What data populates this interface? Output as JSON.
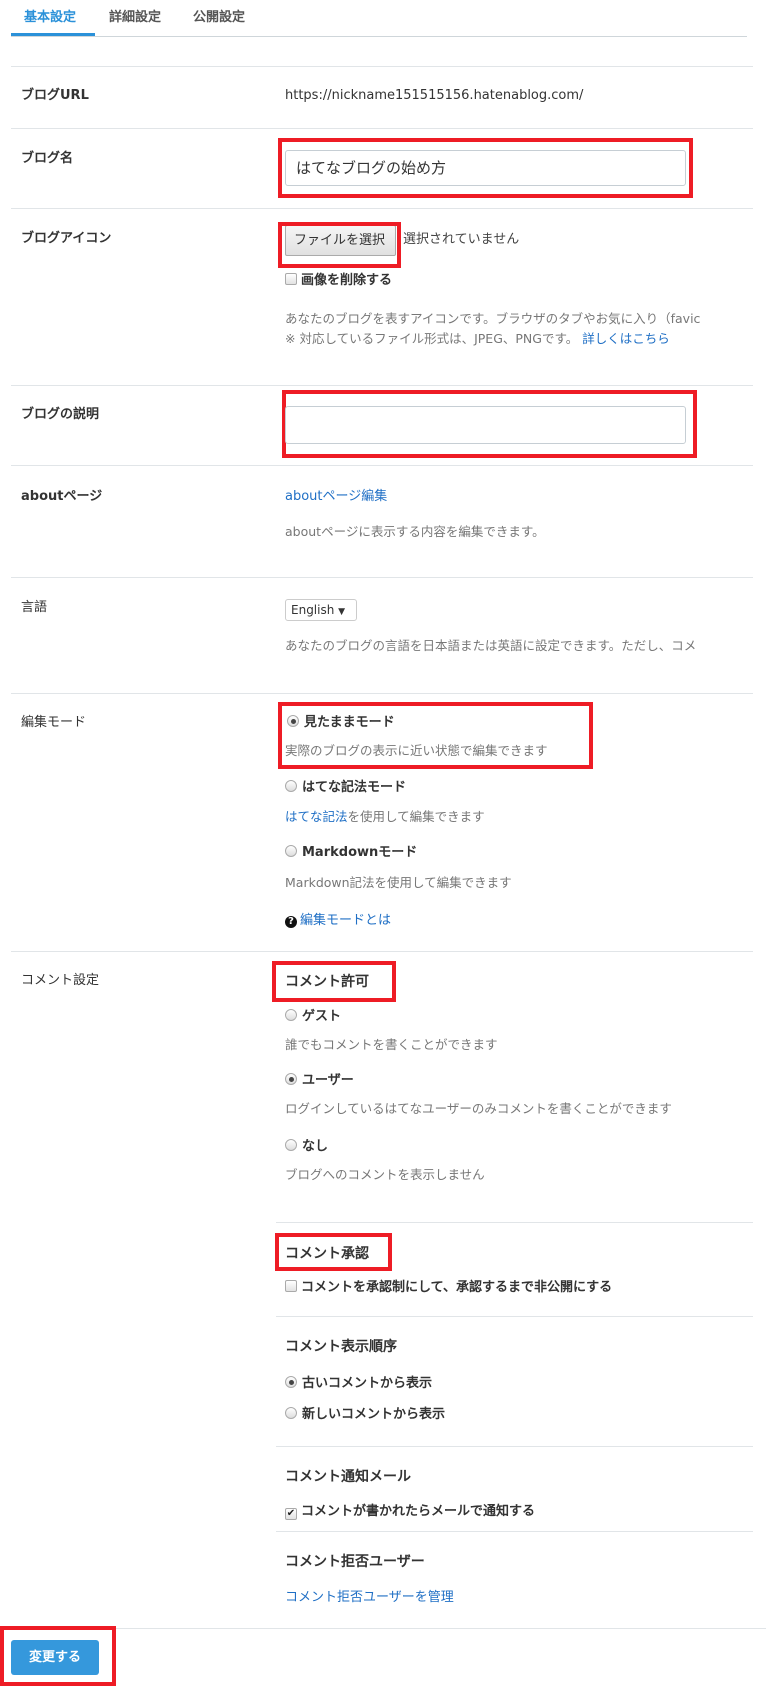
{
  "tabs": [
    {
      "label": "基本設定",
      "active": true
    },
    {
      "label": "詳細設定"
    },
    {
      "label": "公開設定"
    }
  ],
  "colors": {
    "accent": "#2b91d9",
    "link": "#1f6fc5",
    "highlight": "#ee1c25",
    "button": "#3598dc"
  },
  "blog_url": {
    "label": "ブログURL",
    "value": "https://nickname151515156.hatenablog.com/"
  },
  "blog_name": {
    "label": "ブログ名",
    "value": "はてなブログの始め方"
  },
  "blog_icon": {
    "label": "ブログアイコン",
    "file_button": "ファイルを選択",
    "file_status": "選択されていません",
    "delete_label": "画像を削除する",
    "desc1": "あなたのブログを表すアイコンです。ブラウザのタブやお気に入り（favic",
    "desc2": "※ 対応しているファイル形式は、JPEG、PNGです。",
    "more_link": "詳しくはこちら"
  },
  "blog_desc": {
    "label": "ブログの説明",
    "value": ""
  },
  "about": {
    "label": "aboutページ",
    "link": "aboutページ編集",
    "desc": "aboutページに表示する内容を編集できます。"
  },
  "language": {
    "label": "言語",
    "selected": "English",
    "desc": "あなたのブログの言語を日本語または英語に設定できます。ただし、コメ"
  },
  "edit_mode": {
    "label": "編集モード",
    "options": [
      {
        "label": "見たままモード",
        "desc": "実際のブログの表示に近い状態で編集できます",
        "checked": true
      },
      {
        "label": "はてな記法モード",
        "desc_link": "はてな記法",
        "desc": "を使用して編集できます",
        "checked": false
      },
      {
        "label": "Markdownモード",
        "desc": "Markdown記法を使用して編集できます",
        "checked": false
      }
    ],
    "help_link": "編集モードとは"
  },
  "comment": {
    "label": "コメント設定",
    "permission": {
      "title": "コメント許可",
      "options": [
        {
          "label": "ゲスト",
          "desc": "誰でもコメントを書くことができます",
          "checked": false
        },
        {
          "label": "ユーザー",
          "desc": "ログインしているはてなユーザーのみコメントを書くことができます",
          "checked": true
        },
        {
          "label": "なし",
          "desc": "ブログへのコメントを表示しません",
          "checked": false
        }
      ]
    },
    "approval": {
      "title": "コメント承認",
      "checkbox": "コメントを承認制にして、承認するまで非公開にする",
      "checked": false
    },
    "order": {
      "title": "コメント表示順序",
      "options": [
        {
          "label": "古いコメントから表示",
          "checked": true
        },
        {
          "label": "新しいコメントから表示",
          "checked": false
        }
      ]
    },
    "notify": {
      "title": "コメント通知メール",
      "checkbox": "コメントが書かれたらメールで通知する",
      "checked": true
    },
    "blocked": {
      "title": "コメント拒否ユーザー",
      "link": "コメント拒否ユーザーを管理"
    }
  },
  "submit": "変更する"
}
